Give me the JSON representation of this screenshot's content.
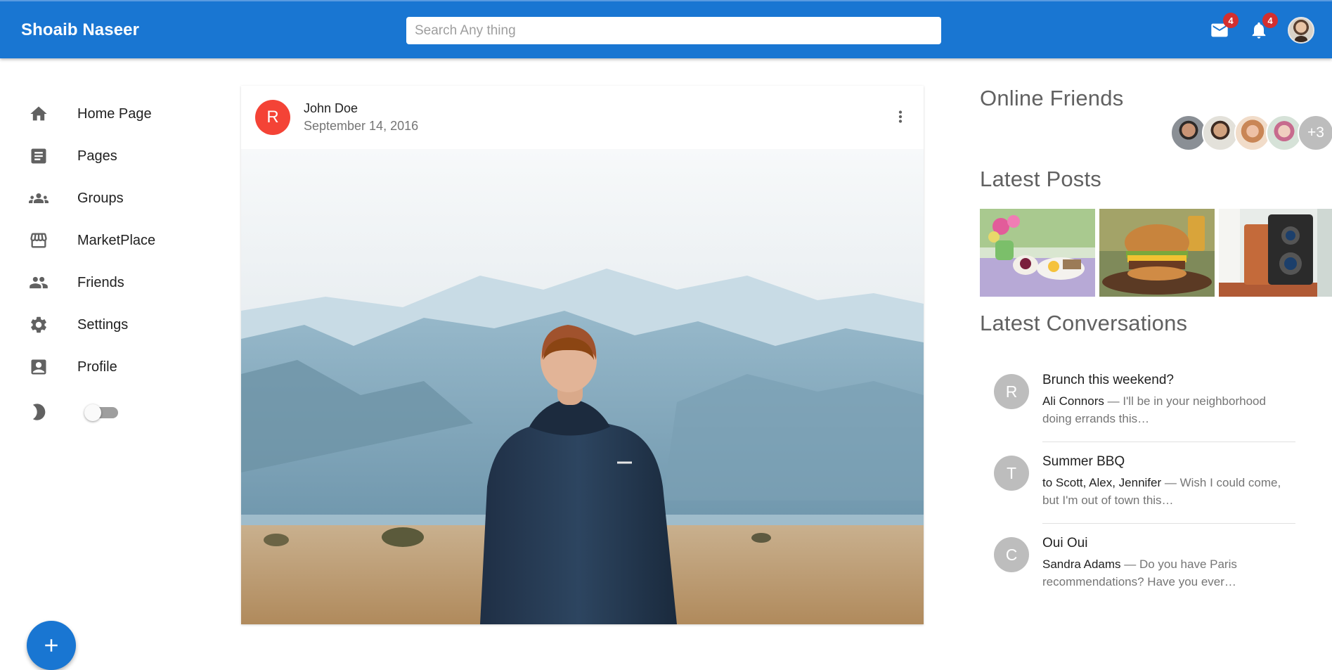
{
  "appbar": {
    "brand": "Shoaib Naseer",
    "search_placeholder": "Search Any thing",
    "mail_icon": "mail-icon",
    "mail_badge": "4",
    "notifications_icon": "bell-icon",
    "notifications_badge": "4"
  },
  "sidebar": {
    "items": [
      {
        "label": "Home Page",
        "icon": "home-icon"
      },
      {
        "label": "Pages",
        "icon": "article-icon"
      },
      {
        "label": "Groups",
        "icon": "groups-icon"
      },
      {
        "label": "MarketPlace",
        "icon": "storefront-icon"
      },
      {
        "label": "Friends",
        "icon": "people-icon"
      },
      {
        "label": "Settings",
        "icon": "gear-icon"
      },
      {
        "label": "Profile",
        "icon": "account-box-icon"
      }
    ],
    "theme_icon": "moon-icon",
    "dark_mode": false,
    "fab_icon": "plus-icon"
  },
  "post": {
    "avatar_letter": "R",
    "author": "John Doe",
    "date": "September 14, 2016",
    "avatar_color": "#f44336"
  },
  "right": {
    "online_friends_title": "Online Friends",
    "online_friends_more": "+3",
    "latest_posts_title": "Latest Posts",
    "latest_conversations_title": "Latest Conversations",
    "conversations": [
      {
        "letter": "R",
        "title": "Brunch this weekend?",
        "from": "Ali Connors",
        "snippet": " — I'll be in your neighborhood doing errands this…"
      },
      {
        "letter": "T",
        "title": "Summer BBQ",
        "from": "to Scott, Alex, Jennifer",
        "snippet": " — Wish I could come, but I'm out of town this…"
      },
      {
        "letter": "C",
        "title": "Oui Oui",
        "from": "Sandra Adams",
        "snippet": " — Do you have Paris recommendations? Have you ever…"
      }
    ]
  },
  "colors": {
    "primary": "#1976d2",
    "badge": "#d32f2f"
  }
}
